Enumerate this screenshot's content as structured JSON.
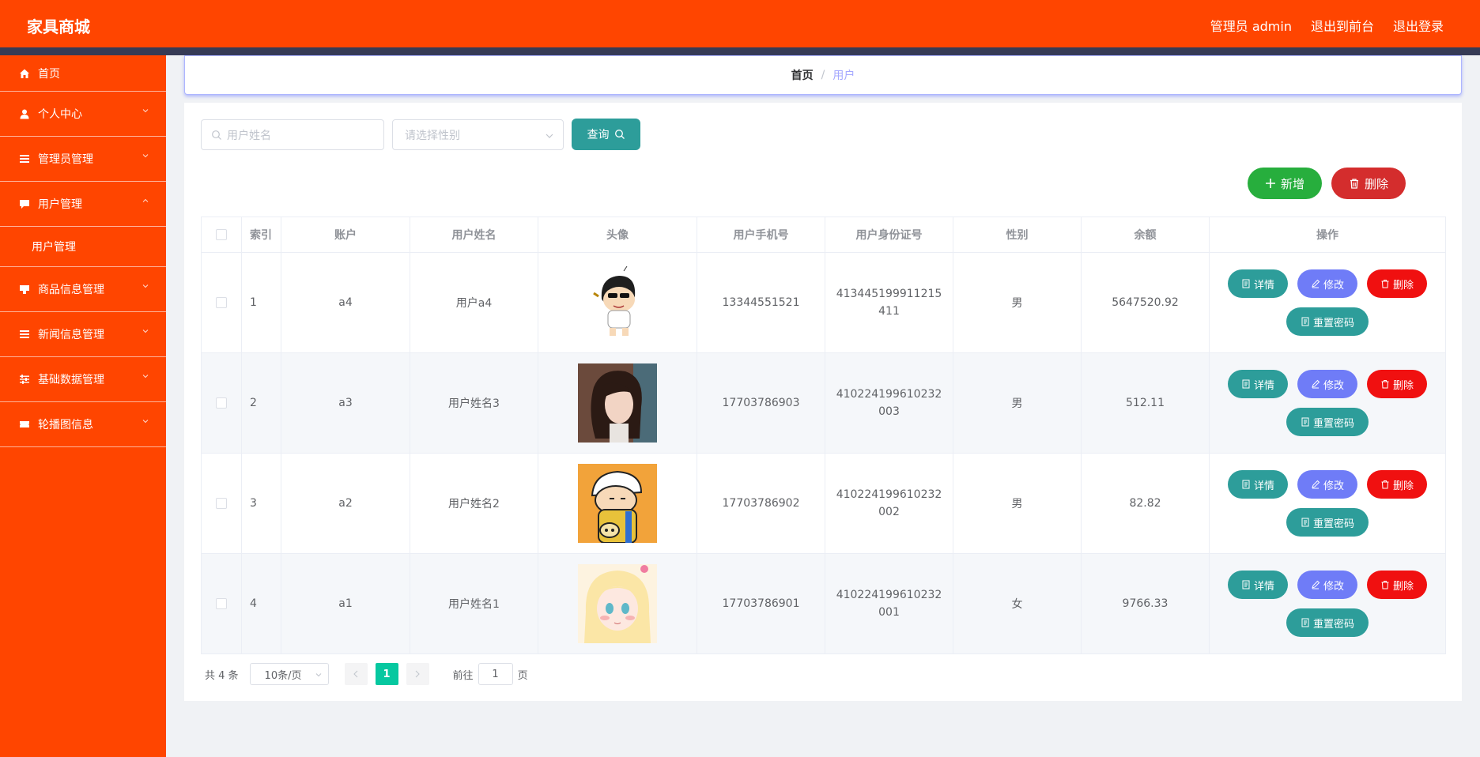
{
  "header": {
    "brand": "家具商城",
    "admin_label": "管理员 admin",
    "exit_front": "退出到前台",
    "logout": "退出登录"
  },
  "sidebar": {
    "items": [
      {
        "label": "首页",
        "icon": "home-icon"
      },
      {
        "label": "个人中心",
        "icon": "user-icon"
      },
      {
        "label": "管理员管理",
        "icon": "list-icon"
      },
      {
        "label": "用户管理",
        "icon": "chat-icon"
      },
      {
        "label": "用户管理",
        "icon": ""
      },
      {
        "label": "商品信息管理",
        "icon": "goods-icon"
      },
      {
        "label": "新闻信息管理",
        "icon": "list-icon"
      },
      {
        "label": "基础数据管理",
        "icon": "sliders-icon"
      },
      {
        "label": "轮播图信息",
        "icon": "ticket-icon"
      }
    ]
  },
  "breadcrumb": {
    "home": "首页",
    "sep": "/",
    "current": "用户"
  },
  "search": {
    "name_placeholder": "用户姓名",
    "gender_placeholder": "请选择性别",
    "query_label": "查询"
  },
  "actions": {
    "add_label": "新增",
    "delete_label": "删除"
  },
  "table": {
    "headers": [
      "索引",
      "账户",
      "用户姓名",
      "头像",
      "用户手机号",
      "用户身份证号",
      "性别",
      "余额",
      "操作"
    ],
    "rows": [
      {
        "index": "1",
        "account": "a4",
        "name": "用户a4",
        "phone": "13344551521",
        "idcard": "413445199911215411",
        "gender": "男",
        "balance": "5647520.92"
      },
      {
        "index": "2",
        "account": "a3",
        "name": "用户姓名3",
        "phone": "17703786903",
        "idcard": "410224199610232003",
        "gender": "男",
        "balance": "512.11"
      },
      {
        "index": "3",
        "account": "a2",
        "name": "用户姓名2",
        "phone": "17703786902",
        "idcard": "410224199610232002",
        "gender": "男",
        "balance": "82.82"
      },
      {
        "index": "4",
        "account": "a1",
        "name": "用户姓名1",
        "phone": "17703786901",
        "idcard": "410224199610232001",
        "gender": "女",
        "balance": "9766.33"
      }
    ],
    "op_labels": {
      "detail": "详情",
      "edit": "修改",
      "delete": "删除",
      "reset": "重置密码"
    }
  },
  "pagination": {
    "total": "共 4 条",
    "page_size": "10条/页",
    "current_page": "1",
    "goto_prefix": "前往",
    "goto_value": "1",
    "goto_suffix": "页"
  },
  "colors": {
    "brand": "#ff4500",
    "teal": "#2d9d9a",
    "green": "#27ae3d",
    "red": "#d42d2d",
    "purple": "#6f7cf7"
  }
}
